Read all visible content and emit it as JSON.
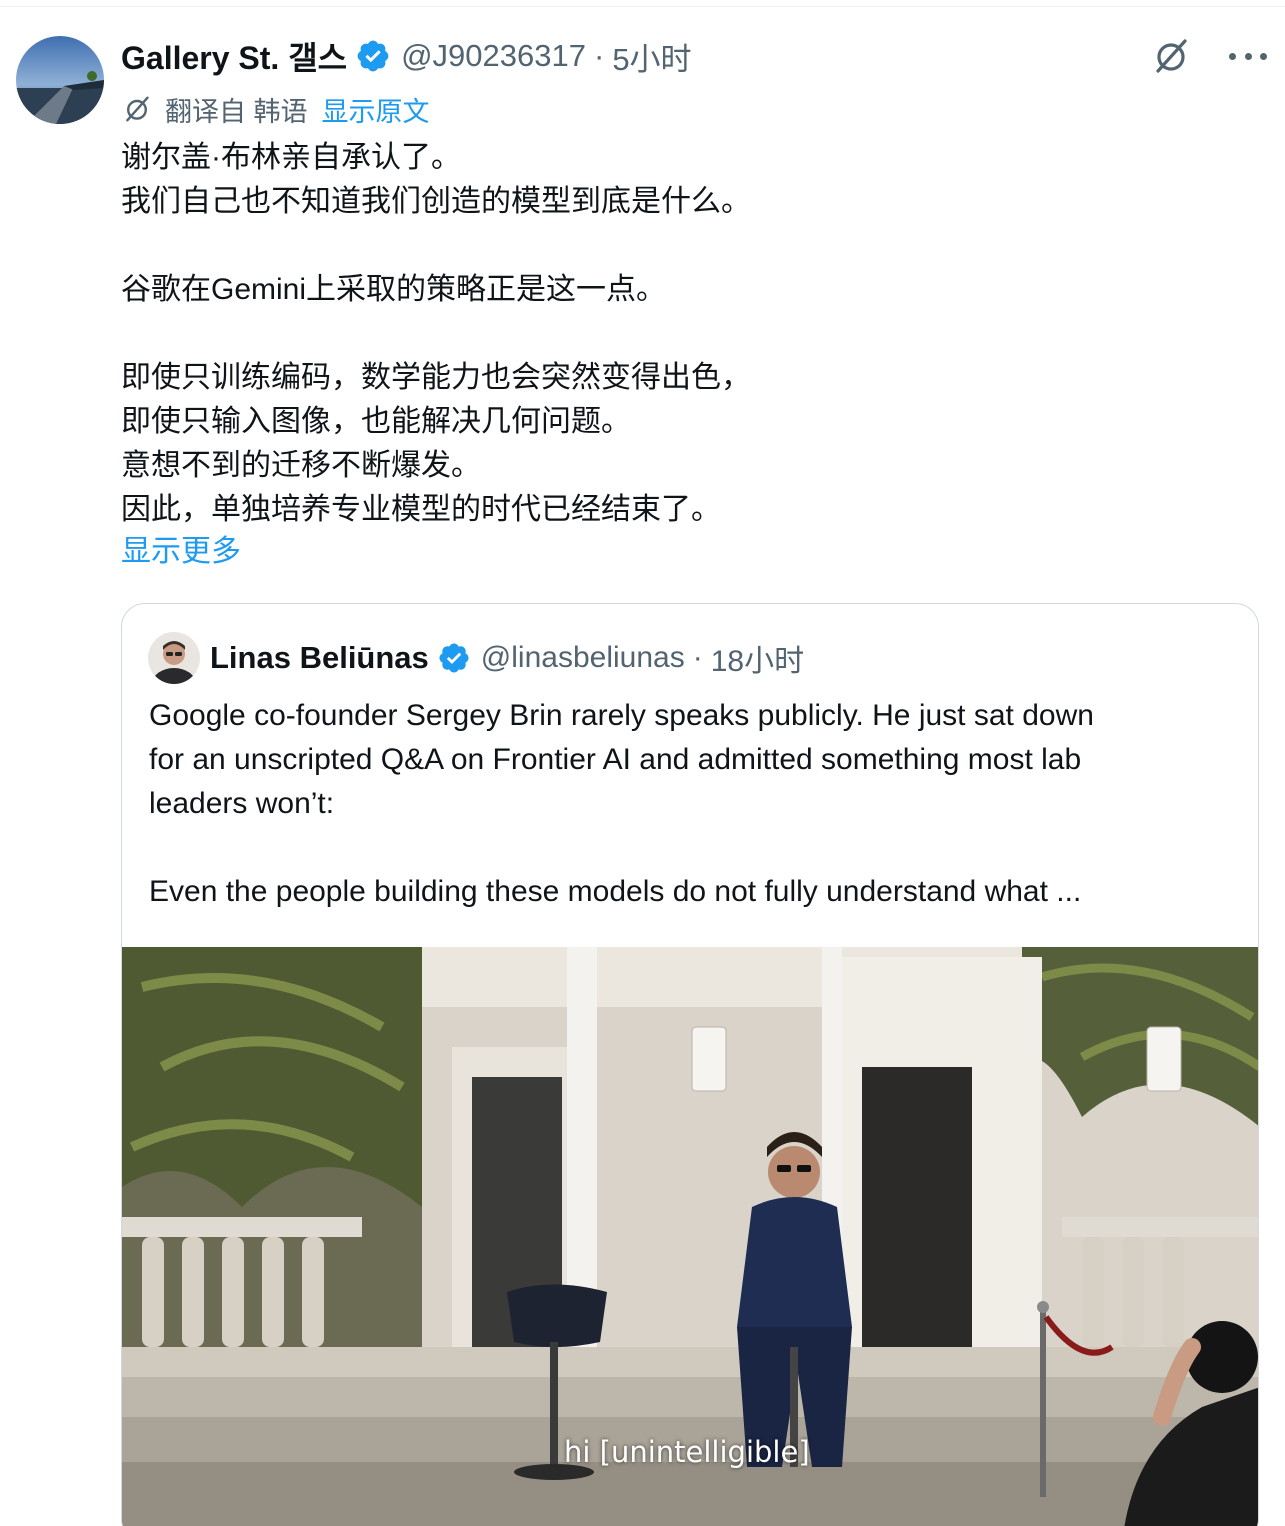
{
  "tweet": {
    "author": {
      "display_name": "Gallery St. 갤스",
      "handle": "@J90236317",
      "verified": true
    },
    "separator": "·",
    "time": "5小时",
    "translation": {
      "label": "翻译自 韩语",
      "show_original": "显示原文"
    },
    "paragraphs": [
      [
        "谢尔盖·布林亲自承认了。",
        "我们自己也不知道我们创造的模型到底是什么。"
      ],
      [
        "谷歌在Gemini上采取的策略正是这一点。"
      ],
      [
        "即使只训练编码，数学能力也会突然变得出色，",
        "即使只输入图像，也能解决几何问题。",
        "意想不到的迁移不断爆发。",
        "因此，单独培养专业模型的时代已经结束了。"
      ]
    ],
    "show_more": "显示更多",
    "actions": {
      "grok_icon": "grok-icon",
      "more_icon": "more-horizontal-icon"
    }
  },
  "quoted_tweet": {
    "author": {
      "display_name": "Linas Beliūnas",
      "handle": "@linasbeliunas",
      "verified": true
    },
    "separator": "·",
    "time": "18小时",
    "paragraphs": [
      [
        "Google co-founder Sergey Brin rarely speaks publicly. He just sat down",
        "for an unscripted Q&A on Frontier AI and admitted something most lab",
        "leaders won’t:"
      ],
      [
        "Even the people building these models do not fully understand what ..."
      ]
    ],
    "media": {
      "type": "video",
      "subtitle": "hi [unintelligible]"
    }
  },
  "colors": {
    "link": "#1d9bf0",
    "verified": "#1d9bf0",
    "secondary_text": "#536471",
    "primary_text": "#0f1419",
    "border": "#cfd9de"
  }
}
